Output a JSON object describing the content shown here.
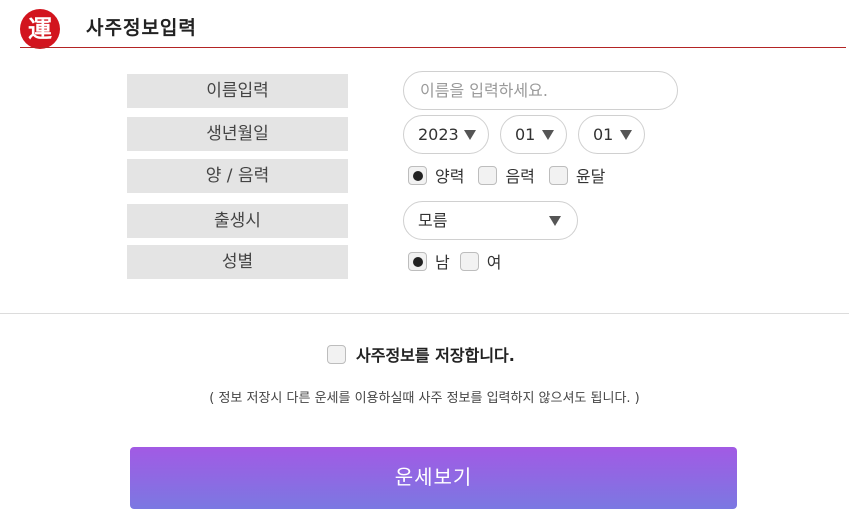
{
  "header": {
    "logo_char": "運",
    "title": "사주정보입력"
  },
  "form": {
    "labels": {
      "name": "이름입력",
      "birth": "생년월일",
      "calendar": "양 / 음력",
      "birth_time": "출생시",
      "gender": "성별"
    },
    "name_placeholder": "이름을 입력하세요.",
    "birth_year": "2023",
    "birth_month": "01",
    "birth_day": "01",
    "calendar_options": [
      {
        "label": "양력",
        "checked": true
      },
      {
        "label": "음력",
        "checked": false
      },
      {
        "label": "윤달",
        "checked": false
      }
    ],
    "birth_time_value": "모름",
    "gender_options": [
      {
        "label": "남",
        "checked": true
      },
      {
        "label": "여",
        "checked": false
      }
    ]
  },
  "save": {
    "label": "사주정보를 저장합니다.",
    "checked": false
  },
  "notice": "( 정보 저장시 다른 운세를 이용하실때 사주 정보를 입력하지 않으셔도 됩니다. )",
  "submit_label": "운세보기"
}
